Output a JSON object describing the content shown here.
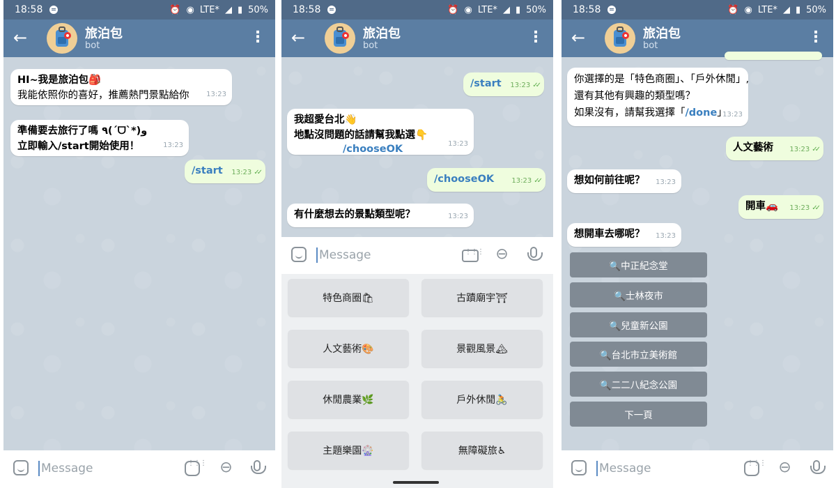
{
  "status": {
    "time": "18:58",
    "network": "LTE*",
    "battery": "50%"
  },
  "chat": {
    "title": "旅泊包",
    "subtitle": "bot"
  },
  "input": {
    "placeholder": "Message"
  },
  "panel1": {
    "msg1_line1": "HI~我是旅泊包🎒",
    "msg1_line2": "我能依照你的喜好，推薦熱門景點給你",
    "msg1_time": "13:23",
    "msg2_line1": "準備要去旅行了嗎 ٩(ˊᗜˋ*)و",
    "msg2_line2": "立即輸入/start開始使用！",
    "msg2_time": "13:23",
    "out1": "/start",
    "out1_time": "13:23"
  },
  "panel2": {
    "out1": "/start",
    "out1_time": "13:23",
    "msg1_line1": "我超愛台北👋",
    "msg1_line2": "地點沒問題的話請幫我點選👇",
    "msg1_cmd": "/chooseOK",
    "msg1_time": "13:23",
    "out2": "/chooseOK",
    "out2_time": "13:23",
    "msg2": "有什麼想去的景點類型呢？",
    "msg2_time": "13:23",
    "keyboard": [
      "特色商圈🛍",
      "古蹟廟宇⛩",
      "人文藝術🎨",
      "景觀風景🏔",
      "休閒農業🌿",
      "戶外休閒🚴",
      "主題樂園🎡",
      "無障礙旅♿"
    ]
  },
  "panel3": {
    "msg1_line1": "你選擇的是「特色商圈」、「戶外休閒」,",
    "msg1_line2": "還有其他有興趣的類型嗎？",
    "msg1_line3a": "如果沒有，請幫我選擇「",
    "msg1_cmd": "/done",
    "msg1_line3b": "」",
    "msg1_time": "13:23",
    "out1": "人文藝術",
    "out1_time": "13:23",
    "msg2": "想如何前往呢？",
    "msg2_time": "13:23",
    "out2": "開車🚗",
    "out2_time": "13:23",
    "msg3": "想開車去哪呢？",
    "msg3_time": "13:23",
    "buttons": [
      "🔍中正紀念堂",
      "🔍士林夜市",
      "🔍兒童新公園",
      "🔍台北市立美術館",
      "🔍二二八紀念公園",
      "下一頁"
    ]
  }
}
